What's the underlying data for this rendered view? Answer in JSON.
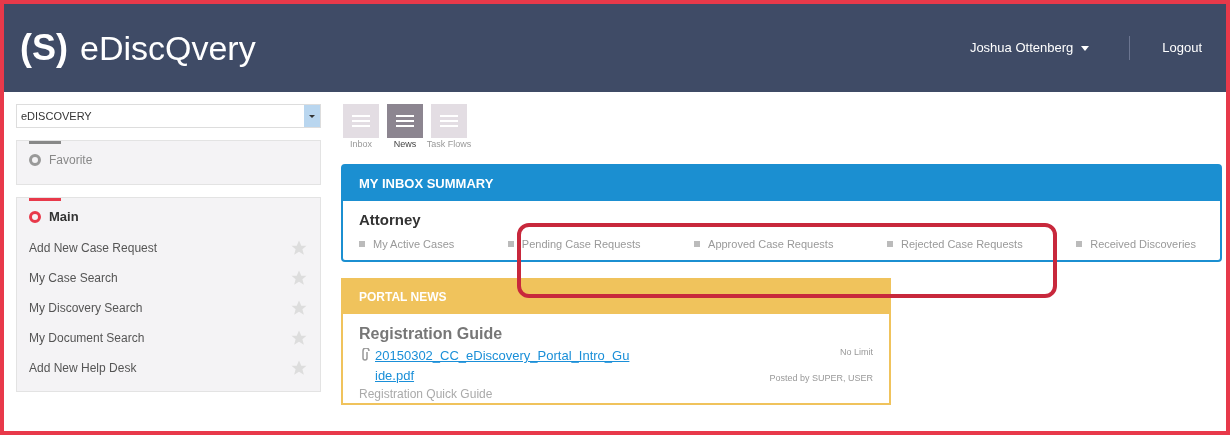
{
  "header": {
    "logo_mark": "(S)",
    "app_name": "eDiscQvery",
    "user": "Joshua Ottenberg",
    "logout": "Logout"
  },
  "sidebar": {
    "dropdown": {
      "value": "eDISCOVERY"
    },
    "sections": [
      {
        "title": "Favorite",
        "kind": "collapsed"
      },
      {
        "title": "Main",
        "kind": "expanded",
        "items": [
          {
            "label": "Add New Case Request"
          },
          {
            "label": "My Case Search"
          },
          {
            "label": "My Discovery Search"
          },
          {
            "label": "My Document Search"
          },
          {
            "label": "Add New Help Desk"
          }
        ]
      }
    ]
  },
  "view_tabs": [
    {
      "label": "Inbox",
      "selected": false
    },
    {
      "label": "News",
      "selected": true
    },
    {
      "label": "Task Flows",
      "selected": false
    }
  ],
  "inbox_summary": {
    "title": "MY INBOX SUMMARY",
    "role": "Attorney",
    "items": [
      "My Active Cases",
      "Pending Case Requests",
      "Approved Case Requests",
      "Rejected Case Requests",
      "Received Discoveries"
    ]
  },
  "portal_news": {
    "title": "PORTAL NEWS",
    "entries": [
      {
        "title": "Registration Guide",
        "attachment": "20150302_CC_eDiscovery_Portal_Intro_Gu",
        "attachment_rest": "ide.pdf",
        "limit": "No Limit",
        "posted_by": "Posted by SUPER, USER",
        "next_title": "Registration Quick Guide"
      }
    ]
  }
}
